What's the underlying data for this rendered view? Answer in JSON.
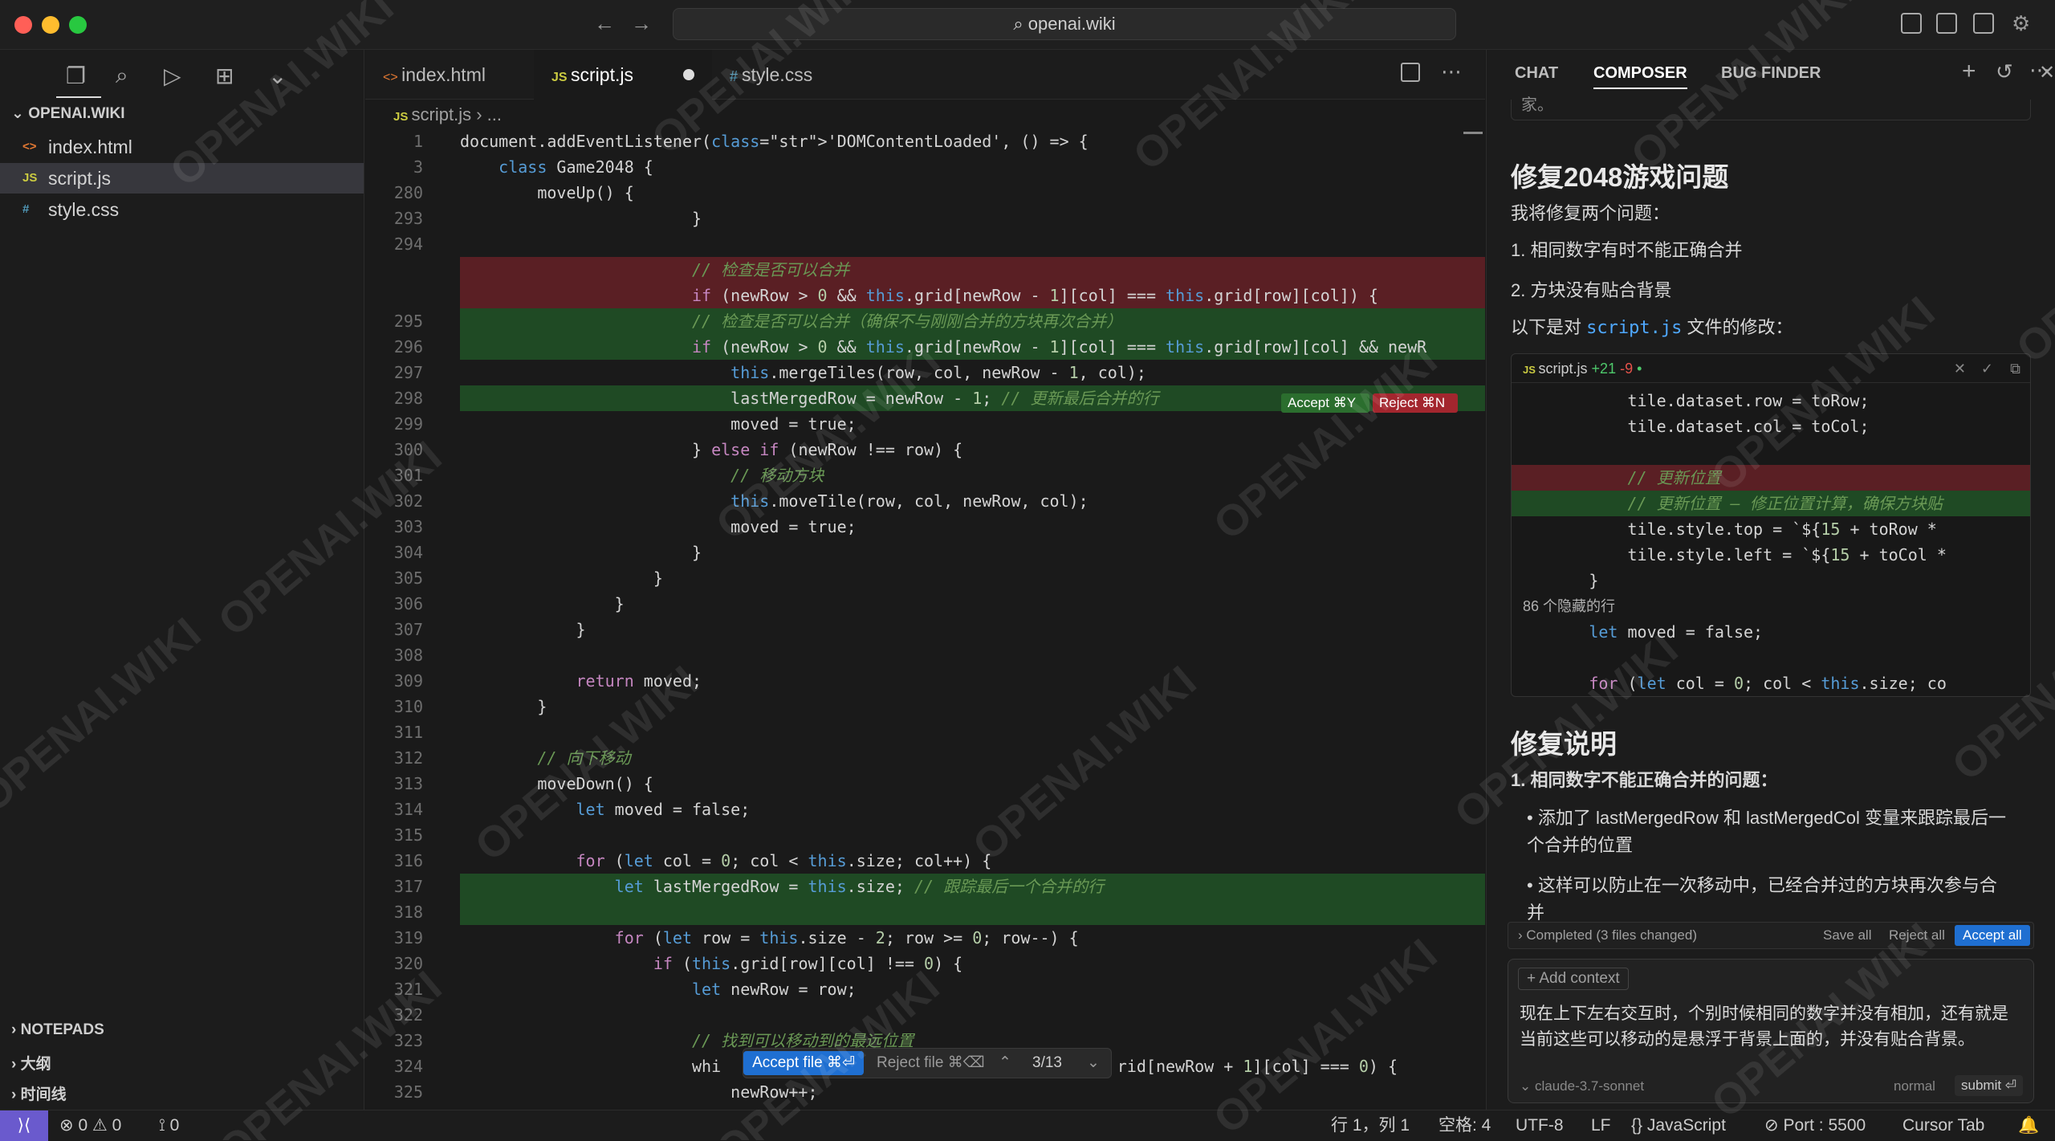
{
  "titlebar": {
    "search": "openai.wiki"
  },
  "sidebar": {
    "workspace": "OPENAI.WIKI",
    "files": [
      {
        "name": "index.html",
        "icon": "<>",
        "color": "#e37933"
      },
      {
        "name": "script.js",
        "icon": "JS",
        "color": "#cbcb41"
      },
      {
        "name": "style.css",
        "icon": "#",
        "color": "#519aba"
      }
    ],
    "sections": [
      "NOTEPADS",
      "大纲",
      "时间线"
    ]
  },
  "tabs": [
    {
      "label": "index.html",
      "icon": "<>"
    },
    {
      "label": "script.js",
      "icon": "JS"
    },
    {
      "label": "style.css",
      "icon": "#"
    }
  ],
  "breadcrumb": {
    "file": "script.js",
    "rest": "..."
  },
  "editor": {
    "lines": [
      {
        "n": "1",
        "t": "document.addEventListener('DOMContentLoaded', () => {",
        "bg": ""
      },
      {
        "n": "3",
        "t": "    class Game2048 {",
        "bg": ""
      },
      {
        "n": "280",
        "t": "        moveUp() {",
        "bg": ""
      },
      {
        "n": "293",
        "t": "                        }",
        "bg": ""
      },
      {
        "n": "294",
        "t": "",
        "bg": ""
      },
      {
        "n": "",
        "t": "                        // 检查是否可以合并",
        "bg": "red"
      },
      {
        "n": "",
        "t": "                        if (newRow > 0 && this.grid[newRow - 1][col] === this.grid[row][col]) {",
        "bg": "red"
      },
      {
        "n": "295",
        "t": "                        // 检查是否可以合并（确保不与刚刚合并的方块再次合并）",
        "bg": "green"
      },
      {
        "n": "296",
        "t": "                        if (newRow > 0 && this.grid[newRow - 1][col] === this.grid[row][col] && newR",
        "bg": "green"
      },
      {
        "n": "297",
        "t": "                            this.mergeTiles(row, col, newRow - 1, col);",
        "bg": ""
      },
      {
        "n": "298",
        "t": "                            lastMergedRow = newRow - 1; // 更新最后合并的行",
        "bg": "green"
      },
      {
        "n": "299",
        "t": "                            moved = true;",
        "bg": ""
      },
      {
        "n": "300",
        "t": "                        } else if (newRow !== row) {",
        "bg": ""
      },
      {
        "n": "301",
        "t": "                            // 移动方块",
        "bg": ""
      },
      {
        "n": "302",
        "t": "                            this.moveTile(row, col, newRow, col);",
        "bg": ""
      },
      {
        "n": "303",
        "t": "                            moved = true;",
        "bg": ""
      },
      {
        "n": "304",
        "t": "                        }",
        "bg": ""
      },
      {
        "n": "305",
        "t": "                    }",
        "bg": ""
      },
      {
        "n": "306",
        "t": "                }",
        "bg": ""
      },
      {
        "n": "307",
        "t": "            }",
        "bg": ""
      },
      {
        "n": "308",
        "t": "",
        "bg": ""
      },
      {
        "n": "309",
        "t": "            return moved;",
        "bg": ""
      },
      {
        "n": "310",
        "t": "        }",
        "bg": ""
      },
      {
        "n": "311",
        "t": "",
        "bg": ""
      },
      {
        "n": "312",
        "t": "        // 向下移动",
        "bg": ""
      },
      {
        "n": "313",
        "t": "        moveDown() {",
        "bg": ""
      },
      {
        "n": "314",
        "t": "            let moved = false;",
        "bg": ""
      },
      {
        "n": "315",
        "t": "",
        "bg": ""
      },
      {
        "n": "316",
        "t": "            for (let col = 0; col < this.size; col++) {",
        "bg": ""
      },
      {
        "n": "317",
        "t": "                let lastMergedRow = this.size; // 跟踪最后一个合并的行",
        "bg": "green"
      },
      {
        "n": "318",
        "t": "",
        "bg": "green"
      },
      {
        "n": "319",
        "t": "                for (let row = this.size - 2; row >= 0; row--) {",
        "bg": ""
      },
      {
        "n": "320",
        "t": "                    if (this.grid[row][col] !== 0) {",
        "bg": ""
      },
      {
        "n": "321",
        "t": "                        let newRow = row;",
        "bg": ""
      },
      {
        "n": "322",
        "t": "",
        "bg": ""
      },
      {
        "n": "323",
        "t": "                        // 找到可以移动到的最远位置",
        "bg": ""
      },
      {
        "n": "324",
        "t": "                        whi                                         rid[newRow + 1][col] === 0) {",
        "bg": ""
      },
      {
        "n": "325",
        "t": "                            newRow++;",
        "bg": ""
      }
    ],
    "inline_accept": "Accept ⌘Y",
    "inline_reject": "Reject ⌘N",
    "accept_file": "Accept file ⌘⏎",
    "reject_file": "Reject file ⌘⌫",
    "diff_position": "3/13"
  },
  "panel": {
    "tabs": [
      "CHAT",
      "COMPOSER",
      "BUG FINDER"
    ],
    "active_tab": "COMPOSER",
    "top_partial": "家。",
    "title": "修复2048游戏问题",
    "intro": "我将修复两个问题：",
    "issues": [
      "1. 相同数字有时不能正确合并",
      "2. 方块没有贴合背景"
    ],
    "edit_prefix": "以下是对",
    "edit_file": "script.js",
    "edit_suffix": "文件的修改：",
    "card": {
      "file": "script.js",
      "added": "+21",
      "removed": "-9",
      "lines": [
        "            tile.dataset.row = toRow;",
        "            tile.dataset.col = toCol;",
        "",
        "            // 更新位置",
        "            // 更新位置 — 修正位置计算，确保方块贴",
        "            tile.style.top = `${15 + toRow *",
        "            tile.style.left = `${15 + toCol *",
        "        }",
        "86 个隐藏的行",
        "        let moved = false;",
        "",
        "        for (let col = 0; col < this.size; co"
      ]
    },
    "explain_title": "修复说明",
    "explain_sub": "1. 相同数字不能正确合并的问题：",
    "bullets": [
      "添加了 lastMergedRow 和 lastMergedCol 变量来跟踪最后一个合并的位置",
      "这样可以防止在一次移动中，已经合并过的方块再次参与合并"
    ],
    "completed": "Completed (3 files changed)",
    "save_all": "Save all",
    "reject_all": "Reject all",
    "accept_all": "Accept all",
    "add_context": "+ Add context",
    "prompt": "现在上下左右交互时，个别时候相同的数字并没有相加，还有就是当前这些可以移动的是悬浮于背景上面的，并没有贴合背景。",
    "model": "claude-3.7-sonnet",
    "mode": "normal",
    "submit": "submit ⏎"
  },
  "statusbar": {
    "errors": "0",
    "warnings": "0",
    "ports": "0",
    "position": "行 1，列 1",
    "spaces": "空格: 4",
    "encoding": "UTF-8",
    "eol": "LF",
    "language": "JavaScript",
    "port": "Port : 5500",
    "tab": "Cursor Tab"
  },
  "watermark": "OPENAI.WIKI"
}
